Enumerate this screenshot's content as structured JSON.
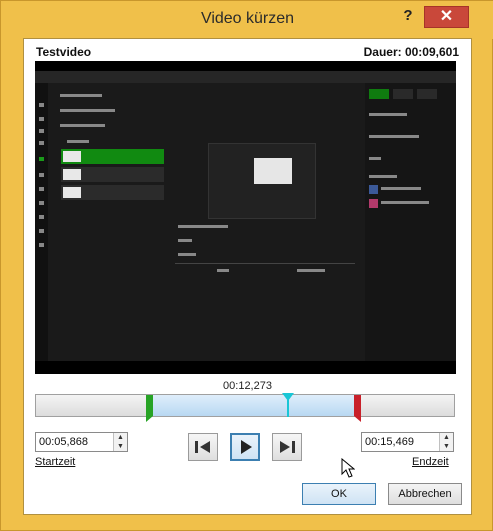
{
  "dialog": {
    "title": "Video kürzen",
    "help_label": "?",
    "close_label": "✕"
  },
  "video": {
    "name": "Testvideo",
    "duration_label": "Dauer: 00:09,601",
    "current_time": "00:12,273"
  },
  "trim": {
    "start_fraction": 0.28,
    "end_fraction": 0.76,
    "playhead_fraction": 0.6
  },
  "start_time": {
    "value": "00:05,868",
    "label": "Startzeit"
  },
  "end_time": {
    "value": "00:15,469",
    "label": "Endzeit"
  },
  "playback": {
    "previous_icon": "previous-frame-icon",
    "play_icon": "play-icon",
    "next_icon": "next-frame-icon"
  },
  "buttons": {
    "ok_label": "OK",
    "cancel_label": "Abbrechen"
  },
  "colors": {
    "title_bar": "#f0c04a",
    "close_button": "#c9483a",
    "start_marker": "#27a325",
    "end_marker": "#c8202a",
    "playhead": "#19c6d6",
    "selection": "#b8d8f2"
  }
}
